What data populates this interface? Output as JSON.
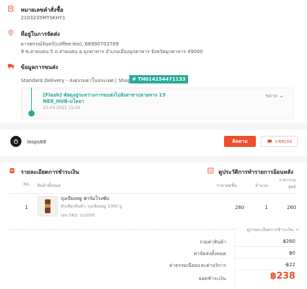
{
  "order": {
    "title": "หมายเลขคำสั่งซื้อ",
    "number": "2103235MYSKHY1"
  },
  "address": {
    "title": "ที่อยู่ในการจัดส่ง",
    "line1": "ดารพรรณ์จันทร์(coffee-leo), 66990703789",
    "line2": "9 ซ.สาดแตน 5 ถ.สาดแตน อ.มุกดาหาร อำเภอเมืองมุกดาหาร จังหวัดมุกดาหาร 49000"
  },
  "shipping": {
    "title": "ข้อมูลการขนส่ง",
    "method": "Standard Delivery - ส่งธรรมดาในประเทศ | Shopee Express",
    "tracking": "# TH014154471133",
    "event_text": "[Flash] พัสดุอยู่ระหว่างการขนส่งไปยังสาขาปลายทาง 15 NE6_HUB-มโดยา",
    "event_time": "25-03-2021 15:26",
    "expand_label": "ขยาย"
  },
  "seller": {
    "name": "leops88",
    "chat_label": "ติดตาม",
    "shop_label": "แชทเลย"
  },
  "payment": {
    "title": "รายละเอียดการชำระเงิน",
    "history_title": "ดูประวัติการทำรายการย้อนหลัง",
    "columns": [
      "No.",
      "สินค้าทั้งหมด",
      "ราคาต่อชิ้น",
      "จำนวน",
      "ราคารวม สุทธิ"
    ],
    "item": {
      "no": "1",
      "name": "ถุงเจียงหยู ฟาร์มโรงซับ",
      "variant": "ตัวเลือกสินค้า: ถุงเจียงหยู 1000 g.",
      "sku": "เลข SKU:  cs1000",
      "unit_price": "260",
      "qty": "1",
      "subtotal": "260"
    },
    "details_link": "ดูรายละเอียดการชำระเงิน",
    "summary": [
      {
        "label": "รวมค่าสินค้า",
        "value": "฿260"
      },
      {
        "label": "ค่าจัดส่งทั้งหมด",
        "value": "฿0"
      },
      {
        "label": "ค่าธรรมเนียมและค่าบริการ",
        "value": "-฿22"
      }
    ],
    "total_label": "ยอดชำระเงิน",
    "total_value": "฿238"
  },
  "colors": {
    "brand": "#ee4d2d",
    "teal": "#26aa99"
  }
}
